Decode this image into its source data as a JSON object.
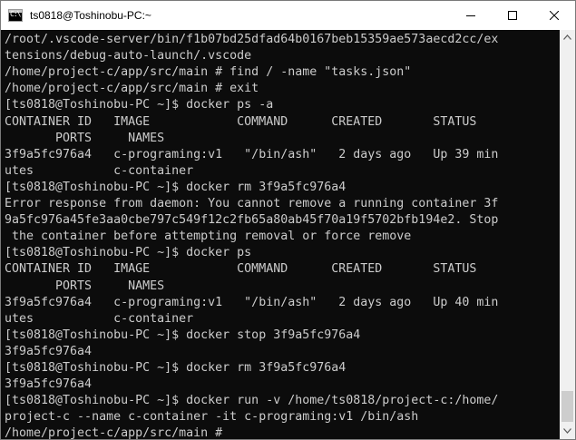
{
  "window": {
    "title": "ts0818@Toshinobu-PC:~",
    "icon": "console-icon",
    "icon_prompt": "C:\\"
  },
  "caption_buttons": {
    "minimize": "minimize-icon",
    "maximize": "maximize-icon",
    "close": "close-icon"
  },
  "console": {
    "lines": [
      "/root/.vscode-server/bin/f1b07bd25dfad64b0167beb15359ae573aecd2cc/ex",
      "tensions/debug-auto-launch/.vscode",
      "/home/project-c/app/src/main # find / -name \"tasks.json\"",
      "/home/project-c/app/src/main # exit",
      "[ts0818@Toshinobu-PC ~]$ docker ps -a",
      "CONTAINER ID   IMAGE            COMMAND      CREATED       STATUS",
      "       PORTS     NAMES",
      "3f9a5fc976a4   c-programing:v1   \"/bin/ash\"   2 days ago   Up 39 min",
      "utes           c-container",
      "[ts0818@Toshinobu-PC ~]$ docker rm 3f9a5fc976a4",
      "Error response from daemon: You cannot remove a running container 3f",
      "9a5fc976a45fe3aa0cbe797c549f12c2fb65a80ab45f70a19f5702bfb194e2. Stop",
      " the container before attempting removal or force remove",
      "[ts0818@Toshinobu-PC ~]$ docker ps",
      "CONTAINER ID   IMAGE            COMMAND      CREATED       STATUS",
      "       PORTS     NAMES",
      "3f9a5fc976a4   c-programing:v1   \"/bin/ash\"   2 days ago   Up 40 min",
      "utes           c-container",
      "[ts0818@Toshinobu-PC ~]$ docker stop 3f9a5fc976a4",
      "3f9a5fc976a4",
      "[ts0818@Toshinobu-PC ~]$ docker rm 3f9a5fc976a4",
      "3f9a5fc976a4",
      "[ts0818@Toshinobu-PC ~]$ docker run -v /home/ts0818/project-c:/home/",
      "project-c --name c-container -it c-programing:v1 /bin/ash",
      "/home/project-c/app/src/main # "
    ]
  },
  "scrollbar": {
    "up": "scroll-up-arrow-icon",
    "down": "scroll-down-arrow-icon"
  },
  "colors": {
    "console_bg": "#0c0c0c",
    "console_fg": "#cccccc",
    "titlebar_bg": "#ffffff",
    "scrollbar_bg": "#f0f0f0"
  }
}
